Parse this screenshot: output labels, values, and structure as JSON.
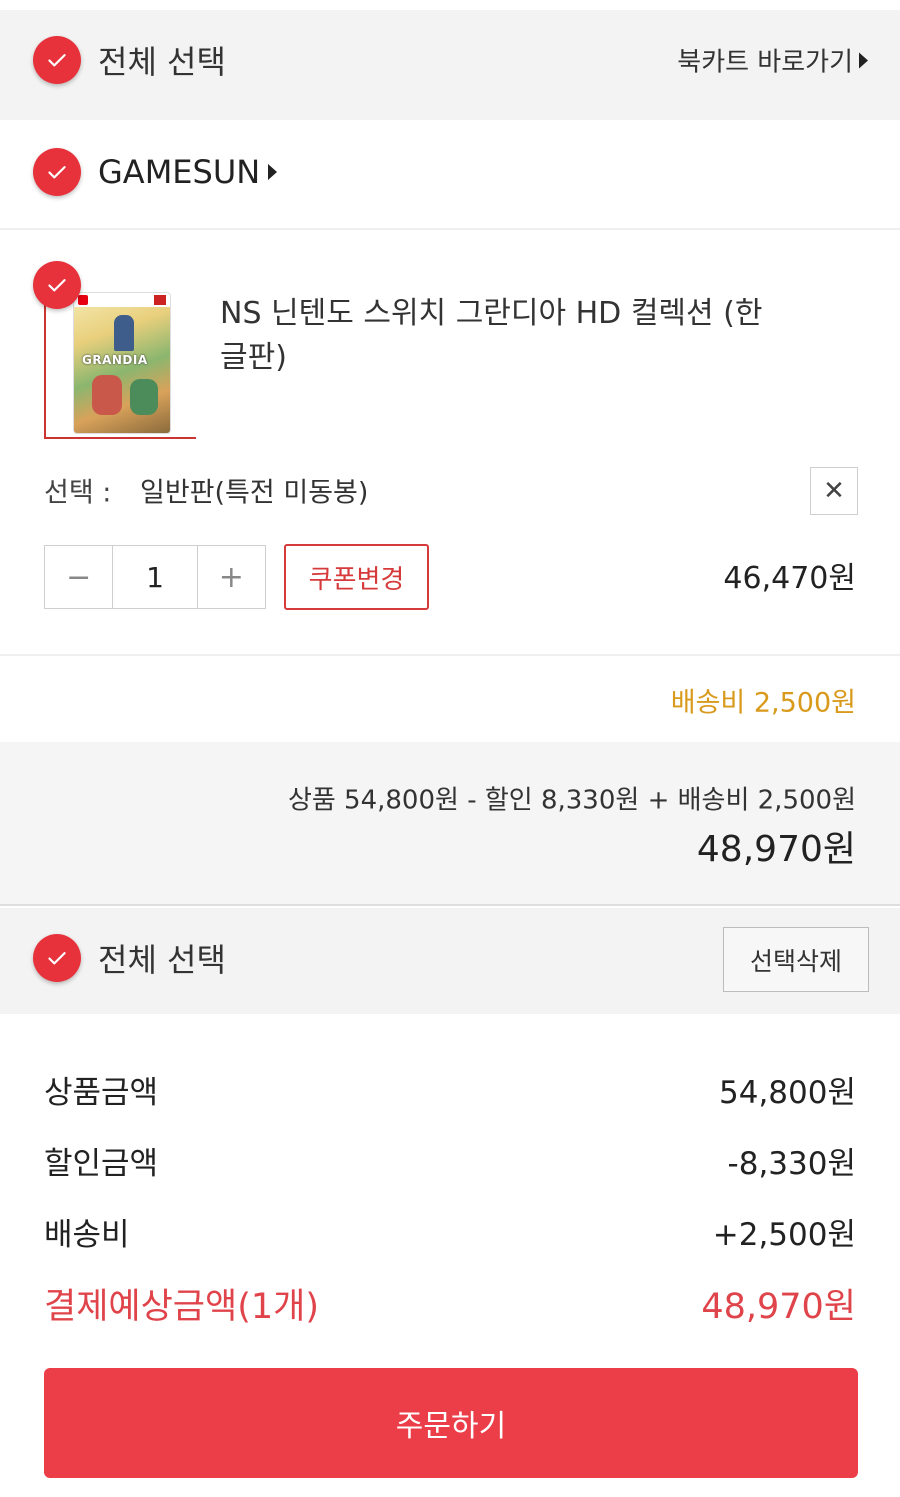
{
  "header": {
    "select_all_label": "전체 선택",
    "cart_link_label": "북카트 바로가기"
  },
  "seller": {
    "name": "GAMESUN"
  },
  "product": {
    "title": "NS 닌텐도 스위치 그란디아 HD 컬렉션 (한글판)",
    "option_label": "선택 :",
    "option_value": "일반판(특전 미동봉)",
    "quantity": "1",
    "minus": "−",
    "plus": "+",
    "remove": "✕",
    "coupon_label": "쿠폰변경",
    "price": "46,470원",
    "shipping_fee": "배송비 2,500원"
  },
  "subtotal": {
    "formula": "상품 54,800원 - 할인 8,330원 + 배송비 2,500원",
    "total": "48,970원"
  },
  "bottom_select": {
    "select_all_label": "전체 선택",
    "delete_selected_label": "선택삭제"
  },
  "summary": {
    "rows": [
      {
        "label": "상품금액",
        "value": "54,800원"
      },
      {
        "label": "할인금액",
        "value": "-8,330원"
      },
      {
        "label": "배송비",
        "value": "+2,500원"
      }
    ],
    "total_label": "결제예상금액(1개)",
    "total_value": "48,970원"
  },
  "order_button_label": "주문하기",
  "colors": {
    "accent": "#e7323c",
    "shipping": "#d99a1c",
    "total_red": "#e0444b"
  }
}
